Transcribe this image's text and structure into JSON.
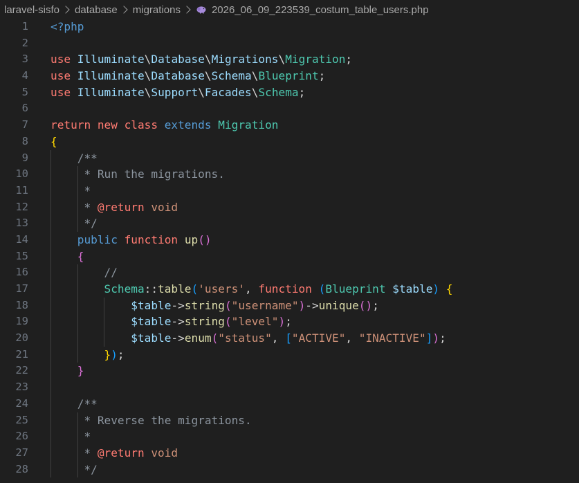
{
  "breadcrumb": {
    "items": [
      "laravel-sisfo",
      "database",
      "migrations"
    ],
    "file": "2026_06_09_223539_costum_table_users.php",
    "file_icon": "php-elephant-icon"
  },
  "editor": {
    "language": "php",
    "lines": [
      {
        "n": "1",
        "tokens": [
          [
            "tag",
            "<?php"
          ]
        ]
      },
      {
        "n": "2",
        "tokens": []
      },
      {
        "n": "3",
        "tokens": [
          [
            "use",
            "use "
          ],
          [
            "ns",
            "Illuminate"
          ],
          [
            "plain",
            "\\"
          ],
          [
            "ns",
            "Database"
          ],
          [
            "plain",
            "\\"
          ],
          [
            "ns",
            "Migrations"
          ],
          [
            "plain",
            "\\"
          ],
          [
            "cls",
            "Migration"
          ],
          [
            "plain",
            ";"
          ]
        ]
      },
      {
        "n": "4",
        "tokens": [
          [
            "use",
            "use "
          ],
          [
            "ns",
            "Illuminate"
          ],
          [
            "plain",
            "\\"
          ],
          [
            "ns",
            "Database"
          ],
          [
            "plain",
            "\\"
          ],
          [
            "ns",
            "Schema"
          ],
          [
            "plain",
            "\\"
          ],
          [
            "cls",
            "Blueprint"
          ],
          [
            "plain",
            ";"
          ]
        ]
      },
      {
        "n": "5",
        "tokens": [
          [
            "use",
            "use "
          ],
          [
            "ns",
            "Illuminate"
          ],
          [
            "plain",
            "\\"
          ],
          [
            "ns",
            "Support"
          ],
          [
            "plain",
            "\\"
          ],
          [
            "ns",
            "Facades"
          ],
          [
            "plain",
            "\\"
          ],
          [
            "cls",
            "Schema"
          ],
          [
            "plain",
            ";"
          ]
        ]
      },
      {
        "n": "6",
        "tokens": []
      },
      {
        "n": "7",
        "tokens": [
          [
            "ret",
            "return "
          ],
          [
            "ret",
            "new "
          ],
          [
            "ret",
            "class "
          ],
          [
            "k-blue",
            "extends "
          ],
          [
            "cls",
            "Migration"
          ]
        ]
      },
      {
        "n": "8",
        "tokens": [
          [
            "brace-y",
            "{"
          ]
        ]
      },
      {
        "n": "9",
        "tokens": [
          [
            "cmt",
            "    /**"
          ]
        ]
      },
      {
        "n": "10",
        "tokens": [
          [
            "cmt",
            "     * Run the migrations."
          ]
        ]
      },
      {
        "n": "11",
        "tokens": [
          [
            "cmt",
            "     *"
          ]
        ]
      },
      {
        "n": "12",
        "tokens": [
          [
            "cmt",
            "     * "
          ],
          [
            "anno",
            "@return"
          ],
          [
            "cmt",
            " "
          ],
          [
            "k-orange",
            "void"
          ]
        ]
      },
      {
        "n": "13",
        "tokens": [
          [
            "cmt",
            "     */"
          ]
        ]
      },
      {
        "n": "14",
        "tokens": [
          [
            "plain",
            "    "
          ],
          [
            "k-blue",
            "public "
          ],
          [
            "ret",
            "function "
          ],
          [
            "fn",
            "up"
          ],
          [
            "brace-p",
            "()"
          ]
        ]
      },
      {
        "n": "15",
        "tokens": [
          [
            "plain",
            "    "
          ],
          [
            "brace-p",
            "{"
          ]
        ]
      },
      {
        "n": "16",
        "tokens": [
          [
            "cmt",
            "        //"
          ]
        ]
      },
      {
        "n": "17",
        "tokens": [
          [
            "plain",
            "        "
          ],
          [
            "cls",
            "Schema"
          ],
          [
            "plain",
            "::"
          ],
          [
            "fn",
            "table"
          ],
          [
            "brace-b",
            "("
          ],
          [
            "str",
            "'users'"
          ],
          [
            "plain",
            ", "
          ],
          [
            "ret",
            "function "
          ],
          [
            "brace-b",
            "("
          ],
          [
            "cls",
            "Blueprint "
          ],
          [
            "var",
            "$table"
          ],
          [
            "brace-b",
            ")"
          ],
          [
            "plain",
            " "
          ],
          [
            "brace-y",
            "{"
          ]
        ]
      },
      {
        "n": "18",
        "tokens": [
          [
            "plain",
            "            "
          ],
          [
            "var",
            "$table"
          ],
          [
            "plain",
            "->"
          ],
          [
            "fn",
            "string"
          ],
          [
            "brace-p",
            "("
          ],
          [
            "str",
            "\"username\""
          ],
          [
            "brace-p",
            ")"
          ],
          [
            "plain",
            "->"
          ],
          [
            "fn",
            "unique"
          ],
          [
            "brace-p",
            "()"
          ],
          [
            "plain",
            ";"
          ]
        ]
      },
      {
        "n": "19",
        "tokens": [
          [
            "plain",
            "            "
          ],
          [
            "var",
            "$table"
          ],
          [
            "plain",
            "->"
          ],
          [
            "fn",
            "string"
          ],
          [
            "brace-p",
            "("
          ],
          [
            "str",
            "\"level\""
          ],
          [
            "brace-p",
            ")"
          ],
          [
            "plain",
            ";"
          ]
        ]
      },
      {
        "n": "20",
        "tokens": [
          [
            "plain",
            "            "
          ],
          [
            "var",
            "$table"
          ],
          [
            "plain",
            "->"
          ],
          [
            "fn",
            "enum"
          ],
          [
            "brace-p",
            "("
          ],
          [
            "str",
            "\"status\""
          ],
          [
            "plain",
            ", "
          ],
          [
            "brace-b",
            "["
          ],
          [
            "str",
            "\"ACTIVE\""
          ],
          [
            "plain",
            ", "
          ],
          [
            "str",
            "\"INACTIVE\""
          ],
          [
            "brace-b",
            "]"
          ],
          [
            "brace-p",
            ")"
          ],
          [
            "plain",
            ";"
          ]
        ]
      },
      {
        "n": "21",
        "tokens": [
          [
            "plain",
            "        "
          ],
          [
            "brace-y",
            "}"
          ],
          [
            "brace-b",
            ")"
          ],
          [
            "plain",
            ";"
          ]
        ]
      },
      {
        "n": "22",
        "tokens": [
          [
            "plain",
            "    "
          ],
          [
            "brace-p",
            "}"
          ]
        ]
      },
      {
        "n": "23",
        "tokens": []
      },
      {
        "n": "24",
        "tokens": [
          [
            "cmt",
            "    /**"
          ]
        ]
      },
      {
        "n": "25",
        "tokens": [
          [
            "cmt",
            "     * Reverse the migrations."
          ]
        ]
      },
      {
        "n": "26",
        "tokens": [
          [
            "cmt",
            "     *"
          ]
        ]
      },
      {
        "n": "27",
        "tokens": [
          [
            "cmt",
            "     * "
          ],
          [
            "anno",
            "@return"
          ],
          [
            "cmt",
            " "
          ],
          [
            "k-orange",
            "void"
          ]
        ]
      },
      {
        "n": "28",
        "tokens": [
          [
            "cmt",
            "     */"
          ]
        ]
      }
    ]
  },
  "colors": {
    "background": "#1f1f1f",
    "line_number": "#6e7681",
    "keyword": "#ff7b72",
    "class": "#4ec9b0",
    "namespace": "#9cdcfe",
    "string": "#ce9178",
    "function": "#dcdcaa",
    "comment": "#8b949e"
  }
}
